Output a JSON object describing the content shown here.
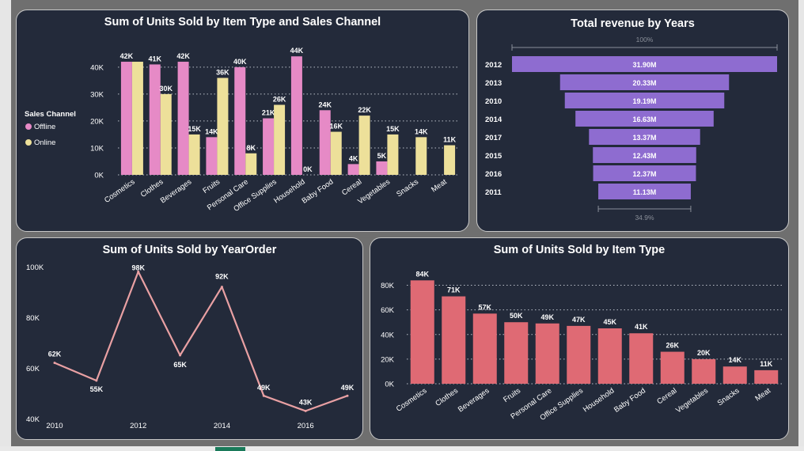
{
  "chart_data": [
    {
      "type": "bar",
      "title": "Sum of Units Sold by Item Type and Sales Channel",
      "legend_title": "Sales Channel",
      "legend_position": "left",
      "categories": [
        "Cosmetics",
        "Clothes",
        "Beverages",
        "Fruits",
        "Personal Care",
        "Office Supplies",
        "Household",
        "Baby Food",
        "Cereal",
        "Vegetables",
        "Snacks",
        "Meat"
      ],
      "series": [
        {
          "name": "Offline",
          "color": "#e68ac6",
          "values": [
            42,
            41,
            42,
            14,
            40,
            21,
            44,
            24,
            4,
            5,
            0,
            0
          ],
          "labels": [
            "42K",
            "41K",
            "42K",
            "14K",
            "40K",
            "21K",
            "44K",
            "24K",
            "4K",
            "5K",
            "",
            ""
          ]
        },
        {
          "name": "Online",
          "color": "#ede09a",
          "values": [
            42,
            30,
            15,
            36,
            8,
            26,
            0,
            16,
            22,
            15,
            14,
            11
          ],
          "labels": [
            "",
            "30K",
            "15K",
            "36K",
            "8K",
            "26K",
            "0K",
            "16K",
            "22K",
            "15K",
            "14K",
            "11K"
          ]
        }
      ],
      "unit": "K",
      "ylim": [
        0,
        47
      ],
      "yticks": [
        0,
        10,
        20,
        30,
        40
      ],
      "ytick_labels": [
        "0K",
        "10K",
        "20K",
        "30K",
        "40K"
      ],
      "grid": true
    },
    {
      "type": "bar",
      "orientation": "funnel",
      "title": "Total revenue by Years",
      "categories": [
        "2012",
        "2013",
        "2010",
        "2014",
        "2017",
        "2015",
        "2016",
        "2011"
      ],
      "values": [
        31.9,
        20.33,
        19.19,
        16.63,
        13.37,
        12.43,
        12.37,
        11.13
      ],
      "labels": [
        "31.90M",
        "20.33M",
        "19.19M",
        "16.63M",
        "13.37M",
        "12.43M",
        "12.37M",
        "11.13M"
      ],
      "top_percent_label": "100%",
      "bottom_percent_label": "34.9%",
      "color": "#8e6cd0"
    },
    {
      "type": "line",
      "title": "Sum of Units Sold by YearOrder",
      "x": [
        2010,
        2011,
        2012,
        2013,
        2014,
        2015,
        2016,
        2017
      ],
      "values": [
        62,
        55,
        98,
        65,
        92,
        49,
        43,
        49
      ],
      "labels": [
        "62K",
        "55K",
        "98K",
        "65K",
        "92K",
        "49K",
        "43K",
        "49K"
      ],
      "xticks": [
        "2010",
        "2012",
        "2014",
        "2016"
      ],
      "yticks": [
        "40K",
        "60K",
        "80K",
        "100K"
      ],
      "ylim": [
        40,
        100
      ],
      "color": "#e9a0a3"
    },
    {
      "type": "bar",
      "title": "Sum of Units Sold by Item Type",
      "categories": [
        "Cosmetics",
        "Clothes",
        "Beverages",
        "Fruits",
        "Personal Care",
        "Office Supplies",
        "Household",
        "Baby Food",
        "Cereal",
        "Vegetables",
        "Snacks",
        "Meat"
      ],
      "values": [
        84,
        71,
        57,
        50,
        49,
        47,
        45,
        41,
        26,
        20,
        14,
        11
      ],
      "labels": [
        "84K",
        "71K",
        "57K",
        "50K",
        "49K",
        "47K",
        "45K",
        "41K",
        "26K",
        "20K",
        "14K",
        "11K"
      ],
      "ylim": [
        0,
        90
      ],
      "yticks": [
        0,
        20,
        40,
        60,
        80
      ],
      "ytick_labels": [
        "0K",
        "20K",
        "40K",
        "60K",
        "80K"
      ],
      "grid": true,
      "color": "#df6a74"
    }
  ]
}
